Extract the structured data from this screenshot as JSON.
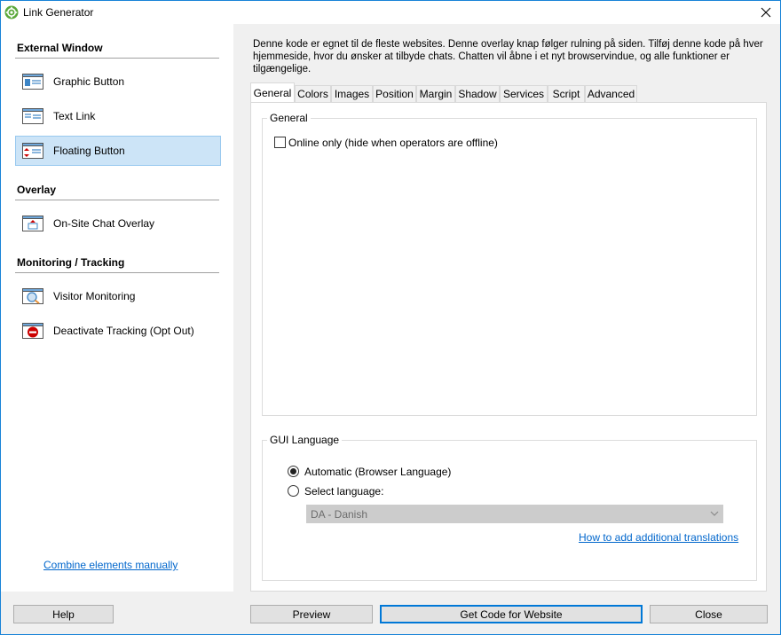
{
  "window": {
    "title": "Link Generator"
  },
  "sidebar": {
    "sections": [
      {
        "title": "External Window",
        "items": [
          {
            "label": "Graphic Button",
            "icon": "graphic-button-icon"
          },
          {
            "label": "Text Link",
            "icon": "text-link-icon"
          },
          {
            "label": "Floating Button",
            "icon": "floating-button-icon",
            "selected": true
          }
        ]
      },
      {
        "title": "Overlay",
        "items": [
          {
            "label": "On-Site Chat Overlay",
            "icon": "chat-overlay-icon"
          }
        ]
      },
      {
        "title": "Monitoring / Tracking",
        "items": [
          {
            "label": "Visitor Monitoring",
            "icon": "visitor-monitoring-icon"
          },
          {
            "label": "Deactivate Tracking (Opt Out)",
            "icon": "opt-out-icon"
          }
        ]
      }
    ],
    "combine_link": "Combine elements manually"
  },
  "main": {
    "description": "Denne kode er egnet til de fleste websites. Denne overlay knap følger rulning på siden. Tilføj denne kode på hver hjemmeside, hvor du ønsker at tilbyde chats. Chatten vil åbne i et nyt browservindue, og alle funktioner er tilgængelige.",
    "tabs": [
      "General",
      "Colors",
      "Images",
      "Position",
      "Margin",
      "Shadow",
      "Services",
      "Script",
      "Advanced"
    ],
    "active_tab": "General",
    "general_group": {
      "title": "General",
      "online_only_label": "Online only (hide when operators are offline)",
      "online_only_checked": false
    },
    "language_group": {
      "title": "GUI Language",
      "automatic_label": "Automatic (Browser Language)",
      "select_label": "Select language:",
      "selected_option": "automatic",
      "language_value": "DA - Danish",
      "translations_link": "How to add additional translations"
    }
  },
  "footer": {
    "help": "Help",
    "preview": "Preview",
    "get_code": "Get Code for Website",
    "close": "Close"
  },
  "colors": {
    "accent": "#0078d7",
    "selection_bg": "#cce4f7",
    "link": "#0066cc"
  }
}
